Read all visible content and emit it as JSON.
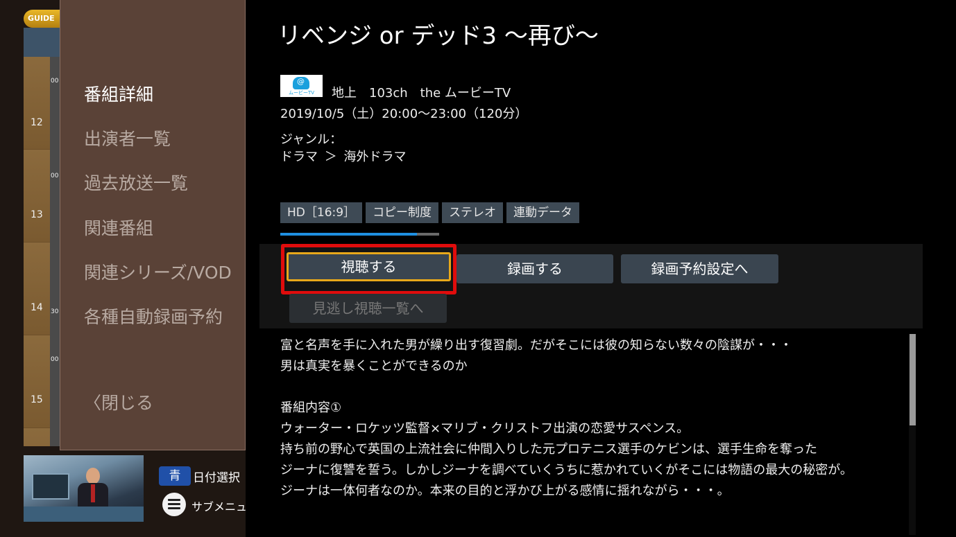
{
  "guide": {
    "logo_text": "GUIDE",
    "hours": [
      "12",
      "13",
      "14",
      "15"
    ],
    "minutes": [
      "00",
      "00",
      "30",
      "00"
    ]
  },
  "side_menu": {
    "items": [
      {
        "label": "番組詳細",
        "active": true
      },
      {
        "label": "出演者一覧",
        "active": false
      },
      {
        "label": "過去放送一覧",
        "active": false
      },
      {
        "label": "関連番組",
        "active": false
      },
      {
        "label": "関連シリーズ/VOD",
        "active": false
      },
      {
        "label": "各種自動録画予約",
        "active": false
      }
    ],
    "close_label": "閉じる"
  },
  "footer": {
    "blue_key": "青",
    "date_select_label": "日付選択",
    "submenu_label": "サブメニュー"
  },
  "program": {
    "title": "リベンジ or デッド3 〜再び〜",
    "channel_logo_text": "ムービーTV",
    "channel_line": "地上　103ch　the ムービーTV",
    "datetime": "2019/10/5（土）20:00〜23:00（120分）",
    "genre_label": "ジャンル：",
    "genre_main": "ドラマ",
    "genre_separator": "＞",
    "genre_sub": "海外ドラマ",
    "tags": [
      "HD［16:9］",
      "コピー制度",
      "ステレオ",
      "連動データ"
    ],
    "progress": 0.86
  },
  "actions": {
    "watch": "視聴する",
    "record": "録画する",
    "reserve_settings": "録画予約設定へ",
    "missed_list": "見逃し視聴一覧へ"
  },
  "description": {
    "lines": [
      "富と名声を手に入れた男が繰り出す復習劇。だがそこには彼の知らない数々の陰謀が・・・",
      "男は真実を暴くことができるのか",
      "",
      "番組内容①",
      "ウォーター・ロケッツ監督×マリブ・クリストフ出演の恋愛サスペンス。",
      "持ち前の野心で英国の上流社会に仲間入りした元プロテニス選手のケビンは、選手生命を奪った",
      "ジーナに復讐を誓う。しかしジーナを調べていくうちに惹かれていくがそこには物語の最大の秘密が。",
      "ジーナは一体何者なのか。本来の目的と浮かび上がる感情に揺れながら・・・。"
    ]
  },
  "colors": {
    "focus_outline": "#e00c0c",
    "focus_border": "#e8a81a",
    "progress_fill": "#1f8fe0",
    "blue_key": "#2050a8"
  }
}
